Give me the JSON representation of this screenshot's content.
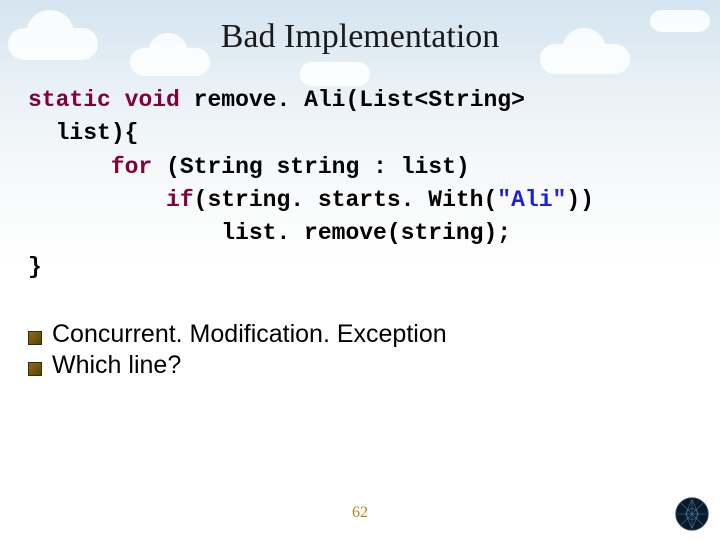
{
  "title": "Bad Implementation",
  "code": {
    "l1a": "static",
    "l1b": " ",
    "l1c": "void",
    "l1d": " remove. Ali(List<String>",
    "l2": "  list){",
    "l3a": "      ",
    "l3b": "for",
    "l3c": " (String string : list)",
    "l4a": "          ",
    "l4b": "if",
    "l4c": "(string. starts. With(",
    "l4d": "\"Ali\"",
    "l4e": "))",
    "l5": "              list. remove(string);",
    "l6": "}"
  },
  "notes": {
    "n1": "Concurrent. Modification. Exception",
    "n2": "Which line?"
  },
  "pagenum": "62"
}
